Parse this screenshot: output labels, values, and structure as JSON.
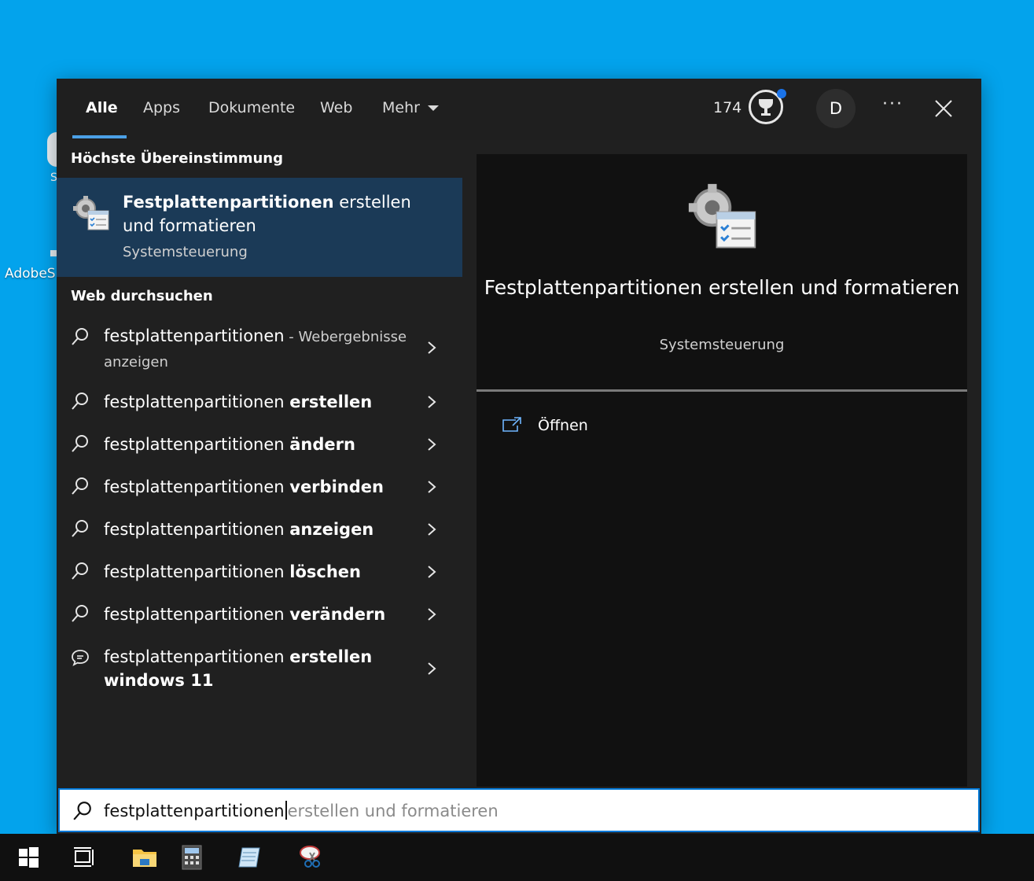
{
  "desktop": {
    "icon1_label": "S",
    "icon2_label": "AdobeS"
  },
  "tabs": [
    {
      "label": "Alle",
      "active": true
    },
    {
      "label": "Apps"
    },
    {
      "label": "Dokumente"
    },
    {
      "label": "Web"
    },
    {
      "label": "Mehr"
    }
  ],
  "header": {
    "points": "174",
    "avatar_initial": "D",
    "more_label": "···",
    "accent_color": "#4ba0e6",
    "notification_color": "#1a73e8"
  },
  "best_match": {
    "heading": "Höchste Übereinstimmung",
    "title_bold": "Festplattenpartitionen",
    "title_rest": " erstellen und formatieren",
    "subtitle": "Systemsteuerung",
    "icon": "control-panel-settings-icon"
  },
  "web": {
    "heading": "Web durchsuchen",
    "items": [
      {
        "prefix": "festplattenpartitionen",
        "bold": "",
        "suffix": " - Webergebnisse anzeigen",
        "icon": "search-icon"
      },
      {
        "prefix": "festplattenpartitionen ",
        "bold": "erstellen",
        "icon": "search-icon"
      },
      {
        "prefix": "festplattenpartitionen ",
        "bold": "ändern",
        "icon": "search-icon"
      },
      {
        "prefix": "festplattenpartitionen ",
        "bold": "verbinden",
        "icon": "search-icon"
      },
      {
        "prefix": "festplattenpartitionen ",
        "bold": "anzeigen",
        "icon": "search-icon"
      },
      {
        "prefix": "festplattenpartitionen ",
        "bold": "löschen",
        "icon": "search-icon"
      },
      {
        "prefix": "festplattenpartitionen ",
        "bold": "verändern",
        "icon": "search-icon"
      },
      {
        "prefix": "festplattenpartitionen ",
        "bold": "erstellen windows 11",
        "icon": "chat-icon"
      }
    ]
  },
  "preview": {
    "title": "Festplattenpartitionen erstellen und formatieren",
    "subtitle": "Systemsteuerung",
    "action_open": "Öffnen"
  },
  "search": {
    "typed": "festplattenpartitionen",
    "suggestion": "erstellen und formatieren"
  },
  "taskbar": {
    "items": [
      "windows-start-icon",
      "task-view-icon",
      "file-explorer-icon",
      "calculator-icon",
      "notepad-icon",
      "snipping-tool-icon"
    ]
  }
}
